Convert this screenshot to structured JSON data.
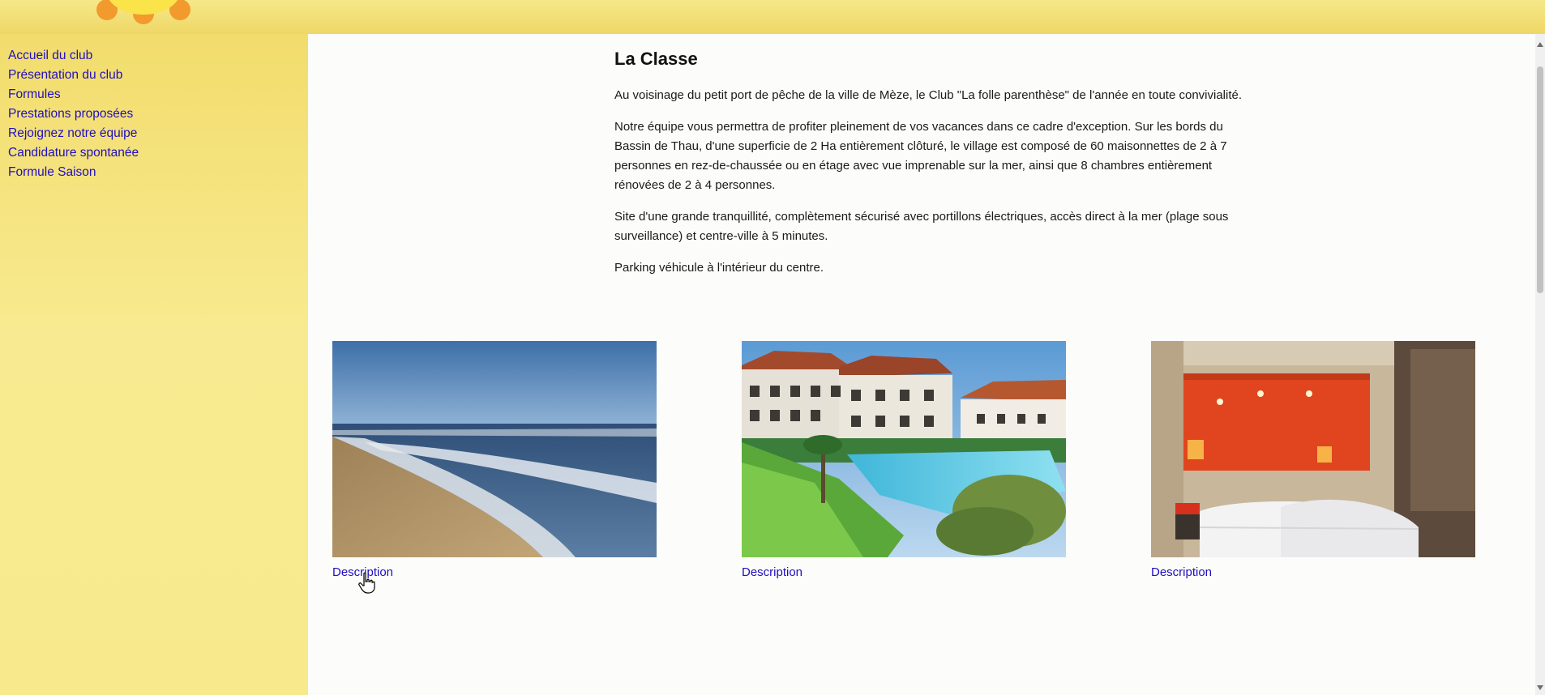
{
  "nav": {
    "items": [
      {
        "label": "Accueil du club"
      },
      {
        "label": "Présentation du club"
      },
      {
        "label": "Formules"
      },
      {
        "label": "Prestations proposées"
      },
      {
        "label": "Rejoignez notre équipe"
      },
      {
        "label": "Candidature spontanée"
      },
      {
        "label": "Formule Saison"
      }
    ]
  },
  "page": {
    "title": "La Classe",
    "paragraphs": [
      "Au voisinage du petit port de pêche de la ville de Mèze, le Club \"La folle parenthèse\" de l'année en toute convivialité.",
      "Notre équipe vous permettra de profiter pleinement de vos vacances dans ce cadre d'exception. Sur les bords du Bassin de Thau, d'une superficie de 2 Ha entièrement clôturé, le village est composé de 60 maisonnettes de 2 à 7 personnes en rez-de-chaussée ou en étage avec vue imprenable sur la mer, ainsi que 8 chambres entièrement rénovées de 2 à 4 personnes.",
      "Site d'une grande tranquillité, complètement sécurisé avec portillons électriques, accès direct à la mer (plage sous surveillance) et centre-ville à 5 minutes.",
      "Parking véhicule à l'intérieur du centre."
    ]
  },
  "gallery": [
    {
      "image": "beach-photo",
      "link": "Description"
    },
    {
      "image": "hotel-pool-photo",
      "link": "Description"
    },
    {
      "image": "bedroom-photo",
      "link": "Description"
    }
  ],
  "colors": {
    "sidebar_bg": "#f5e27a",
    "link": "#1f0fbf",
    "content_bg": "#fcfcfa"
  },
  "icons": [
    "sun-logo-icon",
    "hand-pointer-cursor-icon"
  ]
}
